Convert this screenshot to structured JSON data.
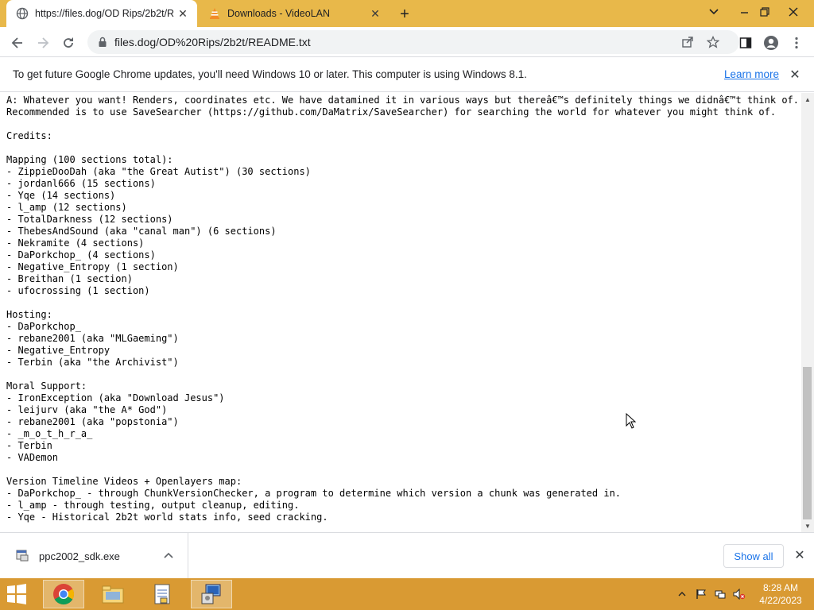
{
  "browser": {
    "tabs": [
      {
        "title": "https://files.dog/OD Rips/2b2t/R",
        "active": true
      },
      {
        "title": "Downloads - VideoLAN",
        "active": false
      }
    ],
    "url": "files.dog/OD%20Rips/2b2t/README.txt"
  },
  "infobar": {
    "message": "To get future Google Chrome updates, you'll need Windows 10 or later. This computer is using Windows 8.1.",
    "link": "Learn more"
  },
  "document": {
    "lines": [
      "A: Whatever you want! Renders, coordinates etc. We have datamined it in various ways but thereâ€™s definitely things we didnâ€™t think of.",
      "Recommended is to use SaveSearcher (https://github.com/DaMatrix/SaveSearcher) for searching the world for whatever you might think of.",
      "",
      "Credits:",
      "",
      "Mapping (100 sections total):",
      "- ZippieDooDah (aka \"the Great Autist\") (30 sections)",
      "- jordanl666 (15 sections)",
      "- Yqe (14 sections)",
      "- l_amp (12 sections)",
      "- TotalDarkness (12 sections)",
      "- ThebesAndSound (aka \"canal man\") (6 sections)",
      "- Nekramite (4 sections)",
      "- DaPorkchop_ (4 sections)",
      "- Negative_Entropy (1 section)",
      "- Breithan (1 section)",
      "- ufocrossing (1 section)",
      "",
      "Hosting:",
      "- DaPorkchop_",
      "- rebane2001 (aka \"MLGaeming\")",
      "- Negative_Entropy",
      "- Terbin (aka \"the Archivist\")",
      "",
      "Moral Support:",
      "- IronException (aka \"Download Jesus\")",
      "- leijurv (aka \"the A* God\")",
      "- rebane2001 (aka \"popstonia\")",
      "- _m_o_t_h_r_a_",
      "- Terbin",
      "- VADemon",
      "",
      "Version Timeline Videos + Openlayers map:",
      "- DaPorkchop_ - through ChunkVersionChecker, a program to determine which version a chunk was generated in.",
      "- l_amp - through testing, output cleanup, editing.",
      "- Yqe - Historical 2b2t world stats info, seed cracking."
    ]
  },
  "downloads": {
    "file": "ppc2002_sdk.exe",
    "show_all": "Show all"
  },
  "taskbar": {
    "time": "8:28 AM",
    "date": "4/22/2023"
  }
}
